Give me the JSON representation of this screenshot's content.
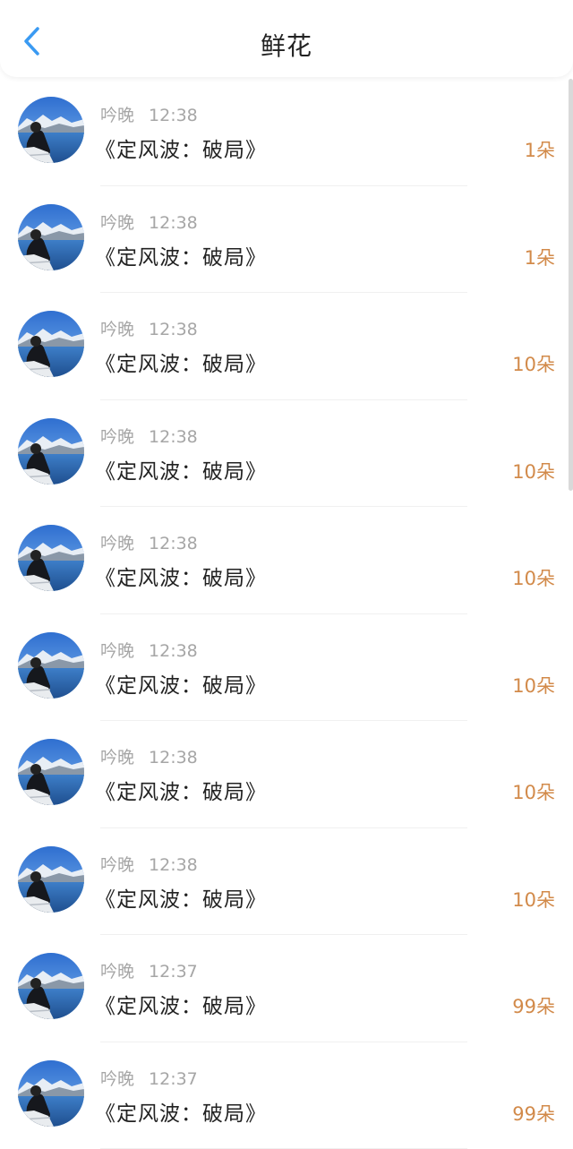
{
  "header": {
    "title": "鲜花",
    "back_icon": "chevron-left-icon",
    "accent_color": "#3a9af2"
  },
  "list": {
    "count_color": "#d28a4a",
    "items": [
      {
        "user": "吟晚",
        "time": "12:38",
        "work": "《定风波：破局》",
        "count": "1朵"
      },
      {
        "user": "吟晚",
        "time": "12:38",
        "work": "《定风波：破局》",
        "count": "1朵"
      },
      {
        "user": "吟晚",
        "time": "12:38",
        "work": "《定风波：破局》",
        "count": "10朵"
      },
      {
        "user": "吟晚",
        "time": "12:38",
        "work": "《定风波：破局》",
        "count": "10朵"
      },
      {
        "user": "吟晚",
        "time": "12:38",
        "work": "《定风波：破局》",
        "count": "10朵"
      },
      {
        "user": "吟晚",
        "time": "12:38",
        "work": "《定风波：破局》",
        "count": "10朵"
      },
      {
        "user": "吟晚",
        "time": "12:38",
        "work": "《定风波：破局》",
        "count": "10朵"
      },
      {
        "user": "吟晚",
        "time": "12:38",
        "work": "《定风波：破局》",
        "count": "10朵"
      },
      {
        "user": "吟晚",
        "time": "12:37",
        "work": "《定风波：破局》",
        "count": "99朵"
      },
      {
        "user": "吟晚",
        "time": "12:37",
        "work": "《定风波：破局》",
        "count": "99朵"
      }
    ]
  }
}
